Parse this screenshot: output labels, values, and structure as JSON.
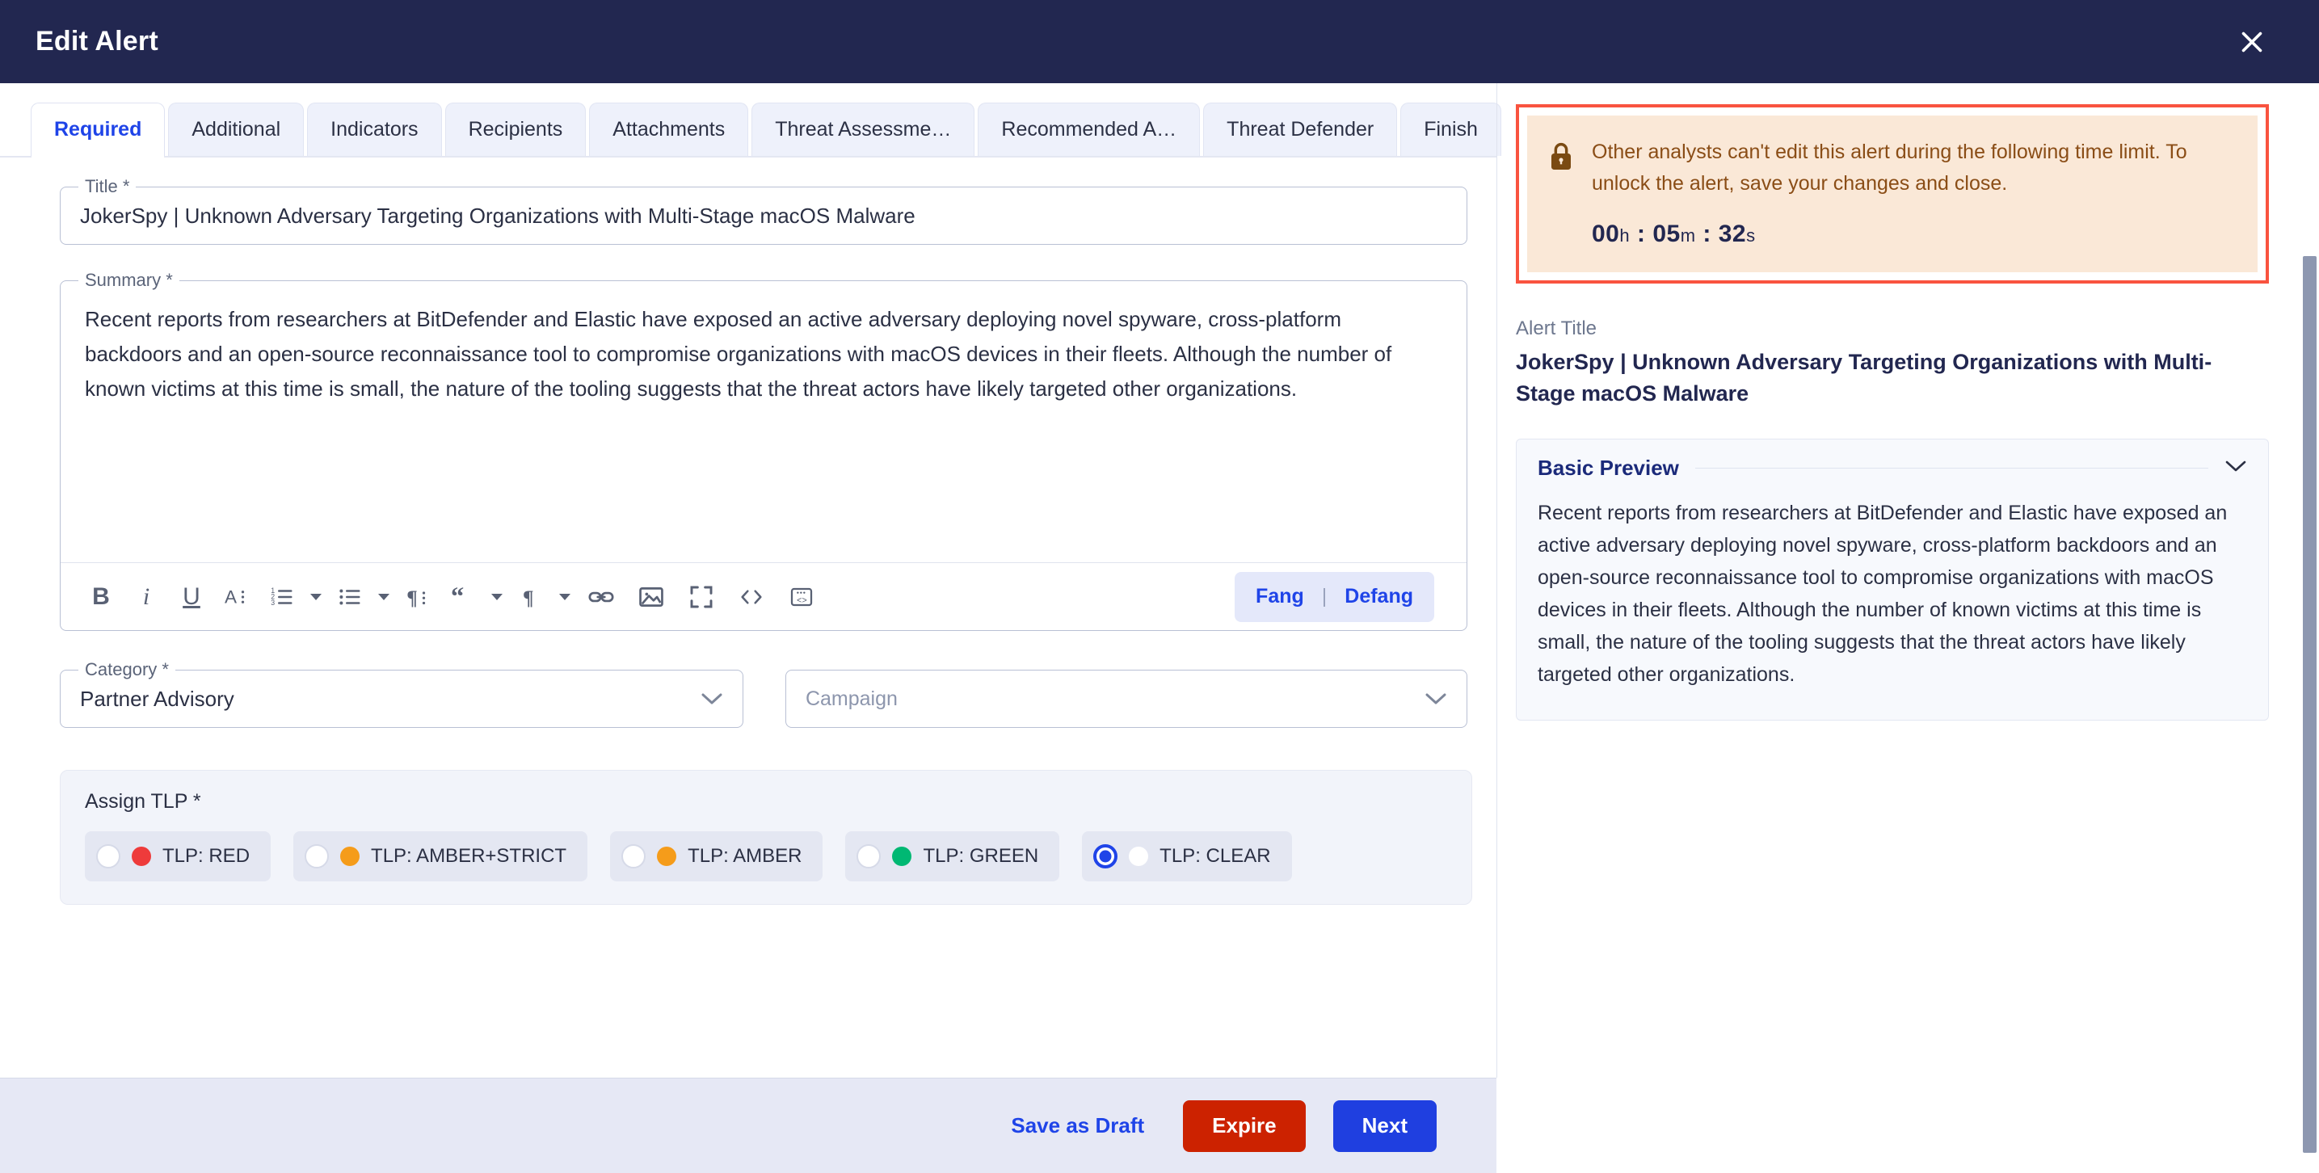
{
  "header": {
    "title": "Edit Alert",
    "close_icon": "close-icon"
  },
  "tabs": [
    {
      "label": "Required",
      "active": true
    },
    {
      "label": "Additional",
      "active": false
    },
    {
      "label": "Indicators",
      "active": false
    },
    {
      "label": "Recipients",
      "active": false
    },
    {
      "label": "Attachments",
      "active": false
    },
    {
      "label": "Threat Assessme…",
      "active": false
    },
    {
      "label": "Recommended A…",
      "active": false
    },
    {
      "label": "Threat Defender",
      "active": false
    },
    {
      "label": "Finish",
      "active": false
    }
  ],
  "form": {
    "title_legend": "Title *",
    "title_value": "JokerSpy | Unknown Adversary Targeting Organizations with Multi-Stage macOS Malware",
    "summary_legend": "Summary *",
    "summary_value": "Recent reports from researchers at BitDefender and Elastic have exposed an active adversary deploying novel spyware, cross-platform backdoors and an open-source reconnaissance tool to compromise organizations with macOS devices in their fleets. Although the number of known victims at this time is small, the nature of the tooling suggests that the threat actors have likely targeted other organizations.",
    "category_legend": "Category *",
    "category_value": "Partner Advisory",
    "campaign_placeholder": "Campaign"
  },
  "editor_toolbar": {
    "tools": [
      {
        "name": "bold-icon",
        "glyph": "B"
      },
      {
        "name": "italic-icon",
        "glyph": "i"
      },
      {
        "name": "underline-icon",
        "glyph": "U"
      },
      {
        "name": "font-color-icon",
        "glyph": "A"
      },
      {
        "name": "ordered-list-icon",
        "glyph": "1≔"
      },
      {
        "name": "unordered-list-icon",
        "glyph": "•≔"
      },
      {
        "name": "paragraph-format-icon",
        "glyph": "¶"
      },
      {
        "name": "blockquote-icon",
        "glyph": "“"
      },
      {
        "name": "paragraph-style-icon",
        "glyph": "¶"
      },
      {
        "name": "link-icon",
        "glyph": "⚭"
      },
      {
        "name": "image-icon",
        "glyph": "⛰"
      },
      {
        "name": "fullscreen-icon",
        "glyph": "⛶"
      },
      {
        "name": "code-icon",
        "glyph": "<>"
      },
      {
        "name": "code-block-icon",
        "glyph": "⌨"
      }
    ],
    "fang_label": "Fang",
    "separator": "|",
    "defang_label": "Defang"
  },
  "tlp": {
    "label": "Assign TLP *",
    "options": [
      {
        "text": "TLP: RED",
        "color": "#ee3b3b",
        "selected": false
      },
      {
        "text": "TLP: AMBER+STRICT",
        "color": "#f59c1a",
        "selected": false
      },
      {
        "text": "TLP: AMBER",
        "color": "#f59c1a",
        "selected": false
      },
      {
        "text": "TLP: GREEN",
        "color": "#00b873",
        "selected": false
      },
      {
        "text": "TLP: CLEAR",
        "color": "#ffffff",
        "selected": true
      }
    ]
  },
  "lock_banner": {
    "icon": "lock-icon",
    "message": "Other analysts can't edit this alert during the following time limit. To unlock the alert, save your changes and close.",
    "hours": "00",
    "hours_unit": "h",
    "minutes": "05",
    "minutes_unit": "m",
    "seconds": "32",
    "seconds_unit": "s",
    "separator": ":",
    "border_color": "#f9533f",
    "fill_color": "#fae8d7"
  },
  "preview": {
    "alert_title_label": "Alert Title",
    "alert_title_value": "JokerSpy | Unknown Adversary Targeting Organizations with Multi-Stage macOS Malware",
    "basic_preview_label": "Basic Preview",
    "chevron_icon": "chevron-down-icon",
    "body_text": "Recent reports from researchers at BitDefender and Elastic have exposed an active adversary deploying novel spyware, cross-platform backdoors and an open-source reconnaissance tool to compromise organizations with macOS devices in their fleets. Although the number of known victims at this time is small, the nature of the tooling suggests that the threat actors have likely targeted other organizations."
  },
  "footer": {
    "save_draft_label": "Save as Draft",
    "expire_label": "Expire",
    "next_label": "Next"
  },
  "colors": {
    "header_bg": "#222750",
    "accent_blue": "#1f44e8",
    "expire_red": "#cc2200",
    "next_blue": "#1f3fe0",
    "footer_bg": "#e6e8f5"
  }
}
